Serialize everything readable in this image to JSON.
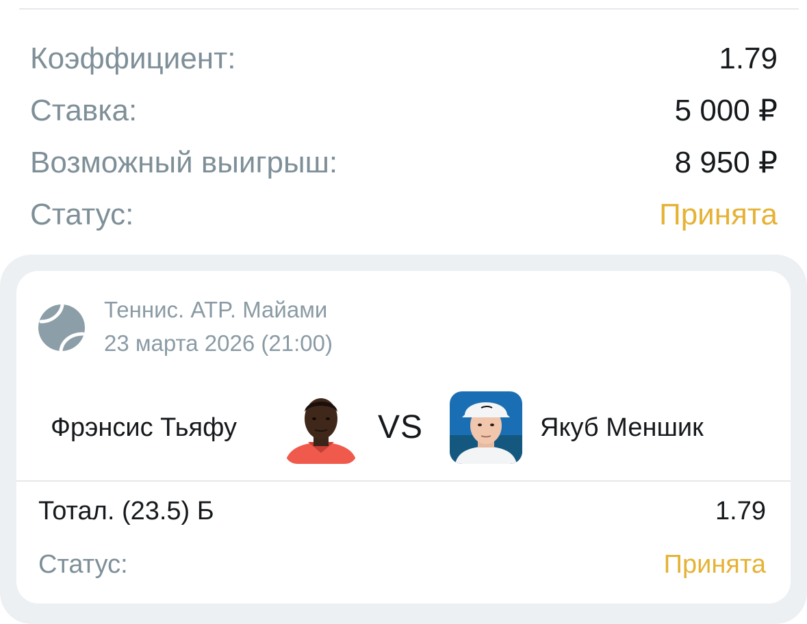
{
  "summary": {
    "coefficient_label": "Коэффициент:",
    "coefficient_value": "1.79",
    "stake_label": "Ставка:",
    "stake_value": "5 000 ₽",
    "potential_win_label": "Возможный выигрыш:",
    "potential_win_value": "8 950 ₽",
    "status_label": "Статус:",
    "status_value": "Принята"
  },
  "event": {
    "sport_league": "Теннис. ATP. Майами",
    "datetime": "23 марта 2026 (21:00)",
    "icon": "tennis-ball-icon",
    "home_player": "Фрэнсис Тьяфу",
    "away_player": "Якуб Меншик",
    "vs_label": "VS"
  },
  "bet": {
    "market": "Тотал. (23.5) Б",
    "coefficient": "1.79",
    "status_label": "Статус:",
    "status_value": "Принята"
  },
  "colors": {
    "label_gray": "#7e8f98",
    "status_accepted": "#e5b234",
    "text_dark": "#16191c",
    "panel_bg": "#edf0f3"
  }
}
